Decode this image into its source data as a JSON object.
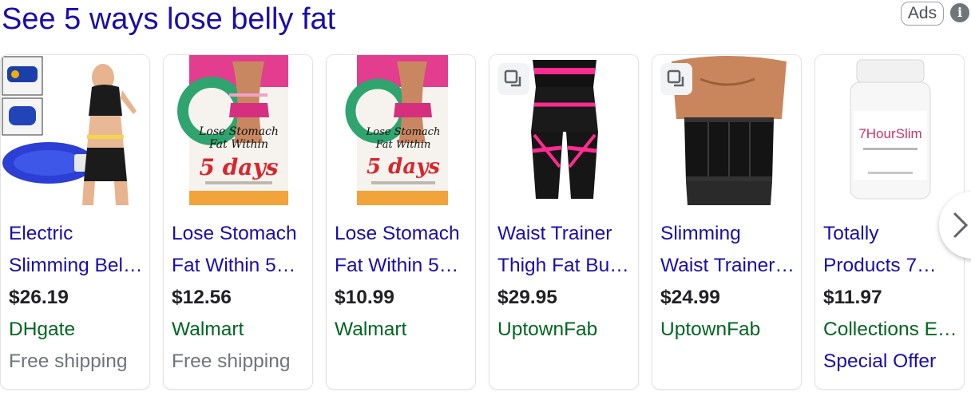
{
  "header": {
    "title": "See 5 ways lose belly fat",
    "ads_label": "Ads",
    "info_icon": "i"
  },
  "cards": [
    {
      "title_1": "Electric",
      "title_2": "Slimming Bel…",
      "price": "$26.19",
      "merchant": "DHgate",
      "extra": "Free shipping",
      "image": "slimming-belt"
    },
    {
      "title_1": "Lose Stomach",
      "title_2": "Fat Within 5…",
      "price": "$12.56",
      "merchant": "Walmart",
      "extra": "Free shipping",
      "image": "book-cover"
    },
    {
      "title_1": "Lose Stomach",
      "title_2": "Fat Within 5…",
      "price": "$10.99",
      "merchant": "Walmart",
      "extra": "",
      "image": "book-cover"
    },
    {
      "title_1": "Waist Trainer",
      "title_2": "Thigh Fat Bur…",
      "price": "$29.95",
      "merchant": "UptownFab",
      "extra": "",
      "image": "waist-thigh-trainer"
    },
    {
      "title_1": "Slimming",
      "title_2": "Waist Trainer…",
      "price": "$24.99",
      "merchant": "UptownFab",
      "extra": "",
      "image": "waist-trainer"
    },
    {
      "title_1": "Totally",
      "title_2": "Products 7…",
      "price": "$11.97",
      "merchant": "Collections E…",
      "extra": "Special Offer",
      "image": "supplement-bottle"
    }
  ],
  "book": {
    "line1": "Lose Stomach",
    "line2": "Fat Within",
    "line3": "5 days"
  },
  "bottle_label": "7HourSlim",
  "colors": {
    "link": "#1a0dab",
    "merchant": "#006621",
    "muted": "#70757a",
    "price": "#202124"
  },
  "icons": {
    "compare": "compare-images-icon",
    "next": "chevron-right-icon",
    "info": "info-icon"
  }
}
